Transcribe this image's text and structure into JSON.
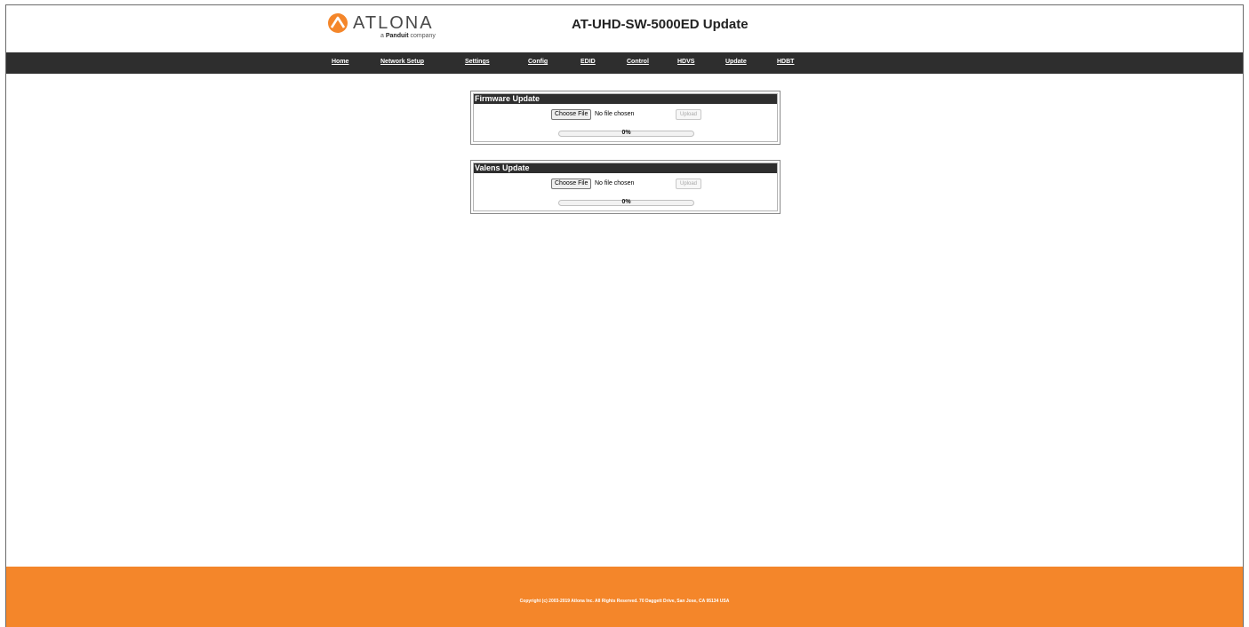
{
  "header": {
    "logo_word": "ATLONA",
    "logo_sub_prefix": "a",
    "logo_sub_brand": "Panduit",
    "logo_sub_suffix": "company",
    "title": "AT-UHD-SW-5000ED Update"
  },
  "nav": {
    "items": [
      "Home",
      "Network Setup",
      "Settings",
      "Config",
      "EDID",
      "Control",
      "HDVS",
      "Update",
      "HDBT"
    ]
  },
  "firmware": {
    "title": "Firmware Update",
    "choose_label": "Choose File",
    "file_status": "No file chosen",
    "upload_label": "Upload",
    "progress_text": "0%",
    "progress": 0
  },
  "valens": {
    "title": "Valens Update",
    "choose_label": "Choose File",
    "file_status": "No file chosen",
    "upload_label": "Upload",
    "progress_text": "0%",
    "progress": 0
  },
  "footer": {
    "copyright": "Copyright (c) 2003-2019 Atlona Inc. All Rights Reserved. 70 Daggett Drive, San Jose, CA 95134 USA"
  },
  "colors": {
    "accent": "#f4862a",
    "navbar": "#2e2e2e"
  }
}
